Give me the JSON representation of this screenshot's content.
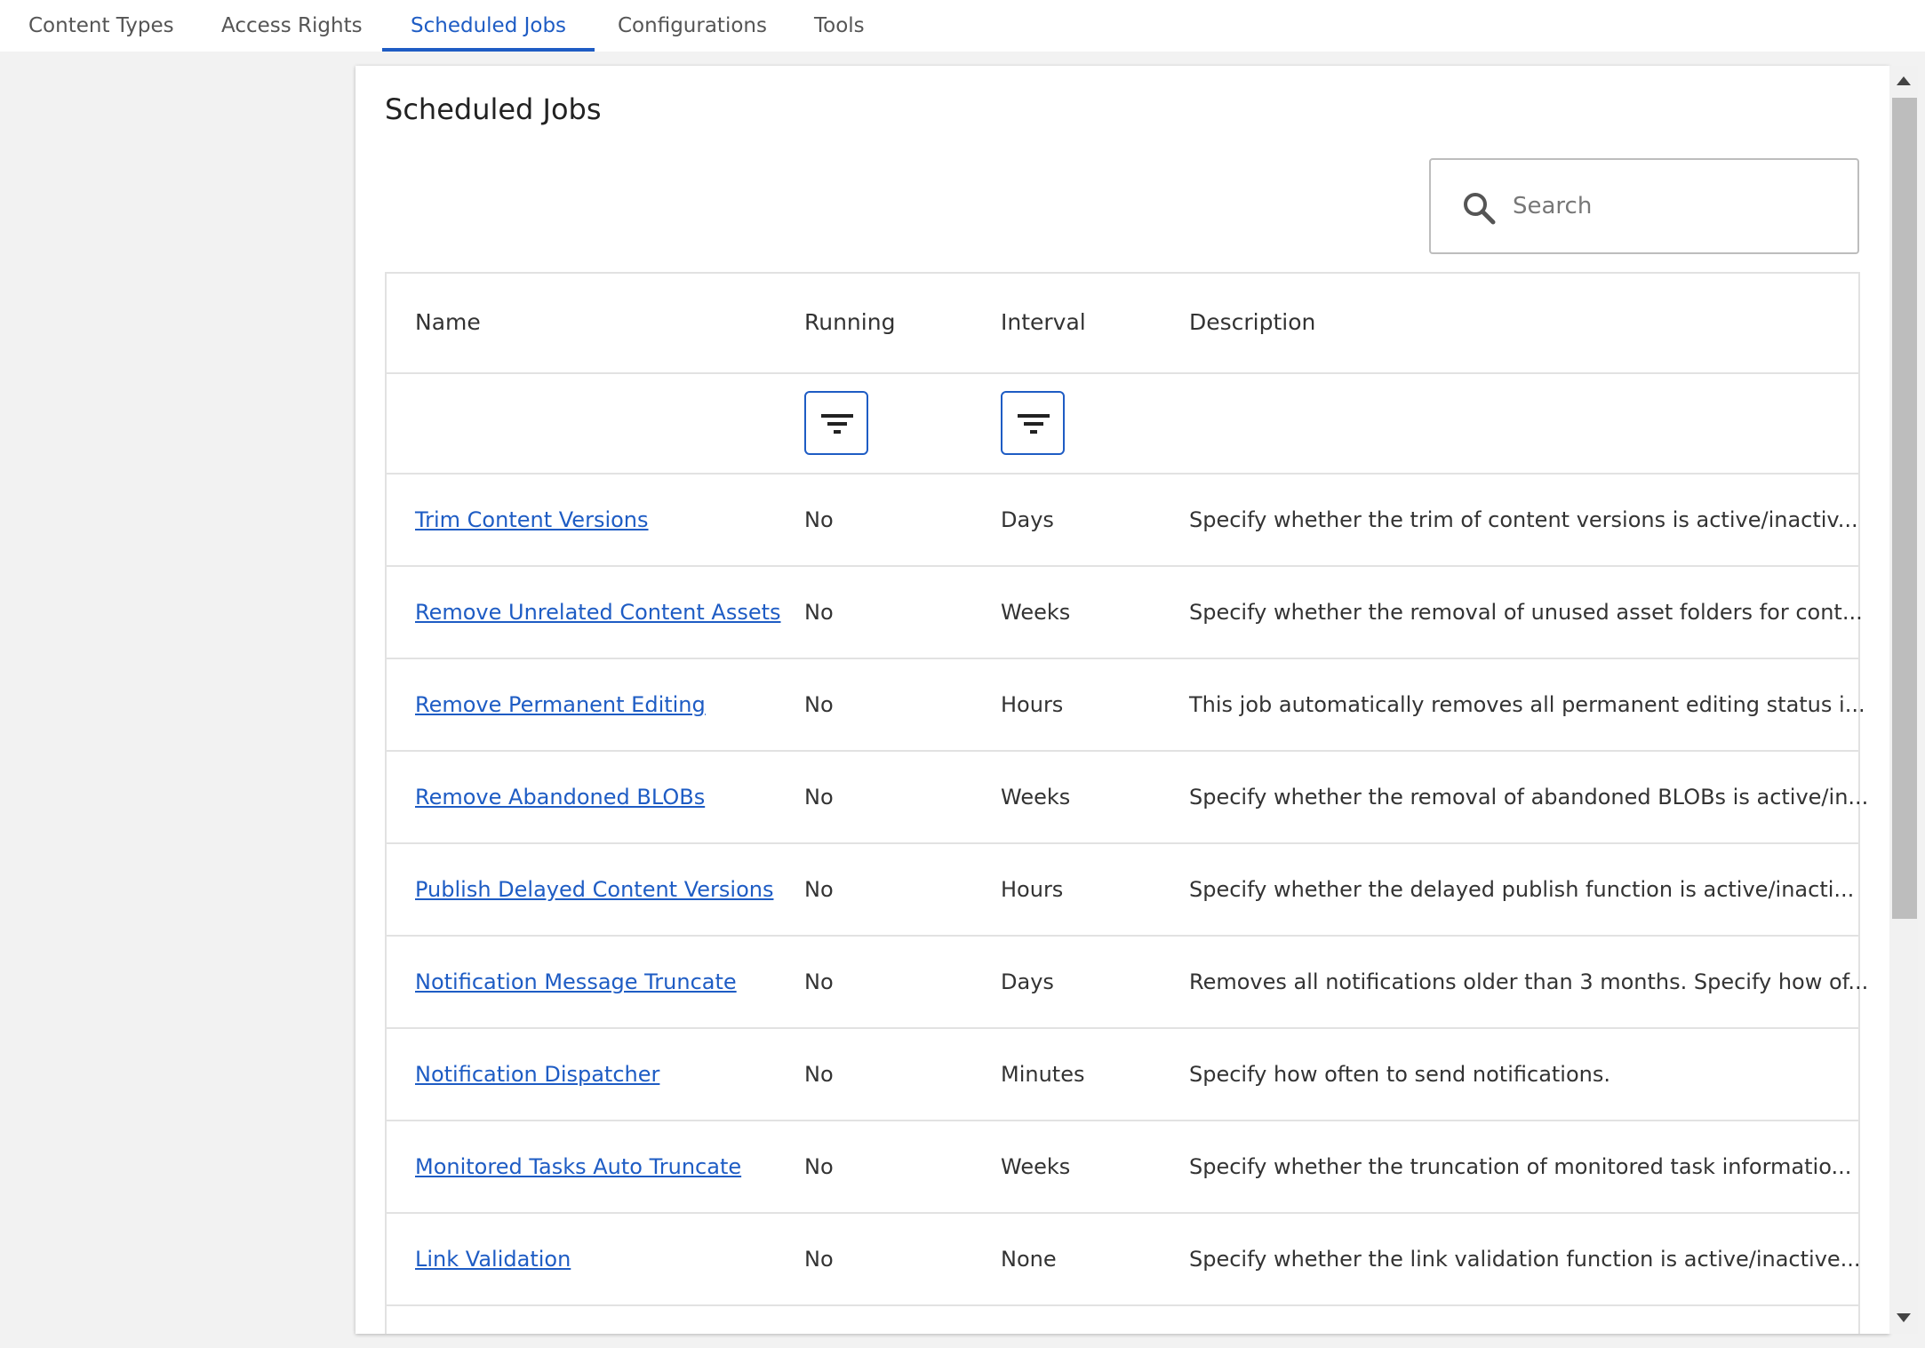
{
  "tabs": [
    {
      "label": "Content Types"
    },
    {
      "label": "Access Rights"
    },
    {
      "label": "Scheduled Jobs",
      "active": true
    },
    {
      "label": "Configurations"
    },
    {
      "label": "Tools"
    }
  ],
  "page": {
    "title": "Scheduled Jobs"
  },
  "search": {
    "placeholder": "Search",
    "value": ""
  },
  "table": {
    "columns": {
      "name": "Name",
      "running": "Running",
      "interval": "Interval",
      "description": "Description"
    },
    "rows": [
      {
        "name": "Trim Content Versions",
        "running": "No",
        "interval": "Days",
        "description": "Specify whether the trim of content versions is active/inactiv..."
      },
      {
        "name": "Remove Unrelated Content Assets",
        "running": "No",
        "interval": "Weeks",
        "description": "Specify whether the removal of unused asset folders for cont..."
      },
      {
        "name": "Remove Permanent Editing",
        "running": "No",
        "interval": "Hours",
        "description": "This job automatically removes all permanent editing status i..."
      },
      {
        "name": "Remove Abandoned BLOBs",
        "running": "No",
        "interval": "Weeks",
        "description": "Specify whether the removal of abandoned BLOBs is active/in..."
      },
      {
        "name": "Publish Delayed Content Versions",
        "running": "No",
        "interval": "Hours",
        "description": "Specify whether the delayed publish function is active/inacti..."
      },
      {
        "name": "Notification Message Truncate",
        "running": "No",
        "interval": "Days",
        "description": "Removes all notifications older than 3 months. Specify how of..."
      },
      {
        "name": "Notification Dispatcher",
        "running": "No",
        "interval": "Minutes",
        "description": "Specify how often to send notifications."
      },
      {
        "name": "Monitored Tasks Auto Truncate",
        "running": "No",
        "interval": "Weeks",
        "description": "Specify whether the truncation of monitored task informatio..."
      },
      {
        "name": "Link Validation",
        "running": "No",
        "interval": "None",
        "description": "Specify whether the link validation function is active/inactive..."
      }
    ]
  },
  "colors": {
    "accent": "#1e5cc4",
    "background": "#f2f2f2",
    "border": "#e2e2e2"
  },
  "icons": {
    "search": "search-icon",
    "filter": "filter-icon"
  }
}
